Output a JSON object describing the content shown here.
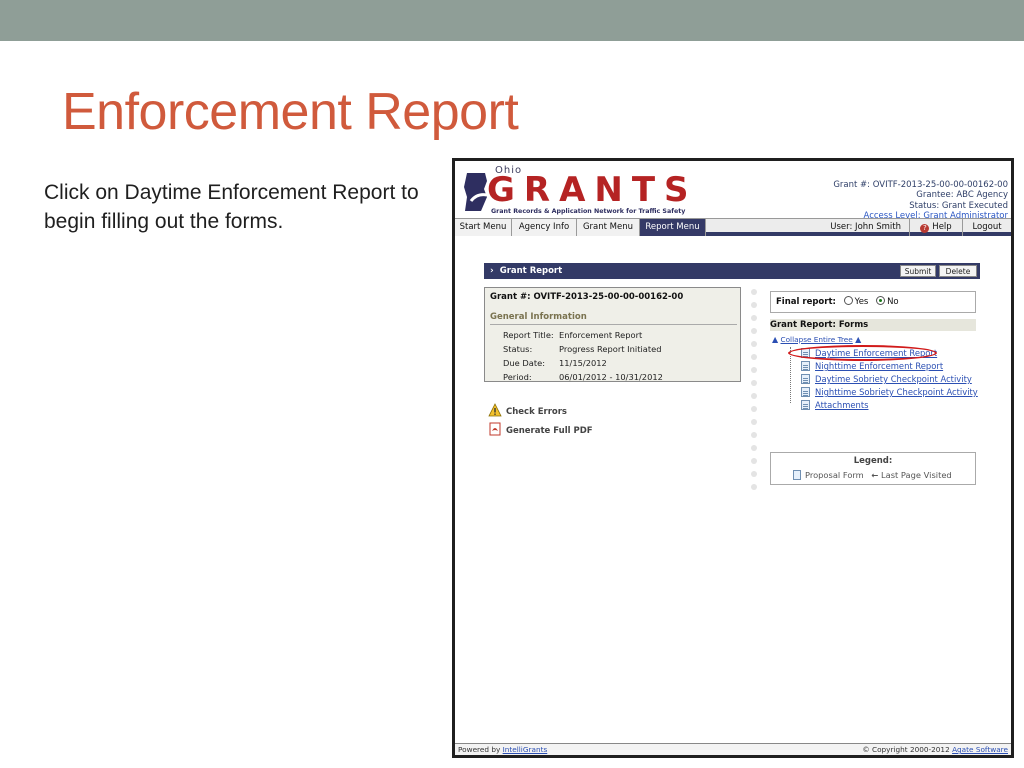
{
  "slide": {
    "title": "Enforcement Report",
    "body": "Click on Daytime Enforcement Report to begin filling out the forms."
  },
  "logo": {
    "ohio": "Ohio",
    "word": "GRANTS",
    "tagline": "Grant Records & Application Network for Traffic Safety"
  },
  "header_info": {
    "grant": "Grant #: OVITF-2013-25-00-00-00162-00",
    "grantee": "Grantee: ABC Agency",
    "status": "Status: Grant Executed",
    "access": "Access Level: Grant Administrator"
  },
  "nav": {
    "items": [
      "Start Menu",
      "Agency Info",
      "Grant Menu",
      "Report Menu"
    ],
    "active": "Report Menu",
    "user": "User: John Smith",
    "help": "Help",
    "logout": "Logout"
  },
  "grant_report": {
    "title": "Grant Report",
    "submit": "Submit",
    "delete": "Delete"
  },
  "info_box": {
    "grant_no": "Grant #: OVITF-2013-25-00-00-00162-00",
    "section": "General Information",
    "rows": [
      {
        "label": "Report Title:",
        "value": "Enforcement Report"
      },
      {
        "label": "Status:",
        "value": "Progress Report Initiated"
      },
      {
        "label": "Due Date:",
        "value": "11/15/2012"
      },
      {
        "label": "Period:",
        "value": "06/01/2012 - 10/31/2012"
      }
    ]
  },
  "actions": {
    "check_errors": "Check Errors",
    "generate_pdf": "Generate Full PDF"
  },
  "final_report": {
    "label": "Final report:",
    "yes": "Yes",
    "no": "No",
    "selected": "No"
  },
  "forms": {
    "heading": "Grant Report: Forms",
    "collapse": "Collapse Entire Tree",
    "items": [
      "Daytime Enforcement Report",
      "Nighttime Enforcement Report",
      "Daytime Sobriety Checkpoint Activity",
      "Nighttime Sobriety Checkpoint Activity",
      "Attachments"
    ],
    "highlighted": "Daytime Enforcement Report"
  },
  "legend": {
    "title": "Legend:",
    "proposal_form": "Proposal Form",
    "last_page": "Last Page Visited"
  },
  "footer": {
    "powered_prefix": "Powered by",
    "powered_link": "IntelliGrants",
    "copyright_prefix": "© Copyright 2000-2012",
    "copyright_link": "Agate Software"
  },
  "colors": {
    "title_accent": "#d05a3c",
    "top_band": "#8f9e97",
    "nav_dark": "#333a66",
    "logo_red": "#b52323",
    "link_blue": "#2b4fb3",
    "highlight_red": "#d11a1a"
  }
}
